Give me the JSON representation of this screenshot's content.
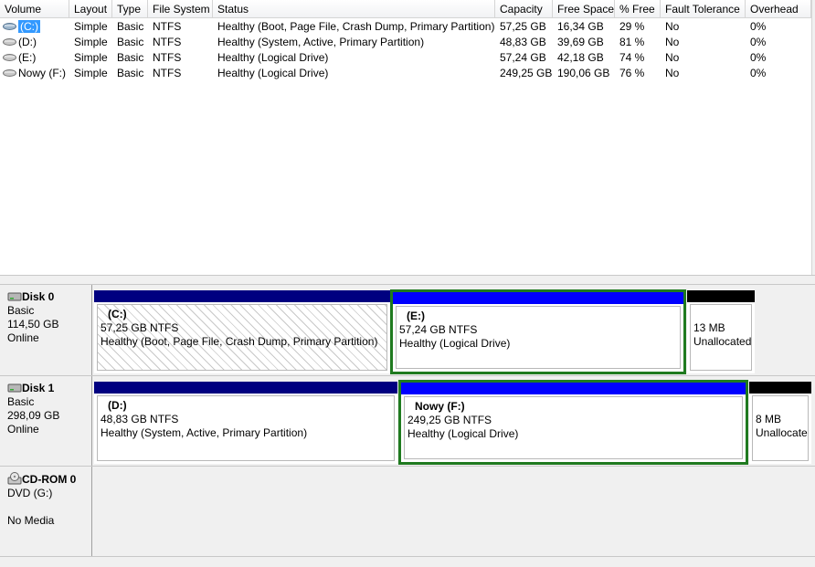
{
  "columns": [
    "Volume",
    "Layout",
    "Type",
    "File System",
    "Status",
    "Capacity",
    "Free Space",
    "% Free",
    "Fault Tolerance",
    "Overhead"
  ],
  "volumes": [
    {
      "volume": "(C:)",
      "layout": "Simple",
      "type": "Basic",
      "fs": "NTFS",
      "status": "Healthy (Boot, Page File, Crash Dump, Primary Partition)",
      "capacity": "57,25 GB",
      "free": "16,34 GB",
      "pct": "29 %",
      "fault": "No",
      "overhead": "0%"
    },
    {
      "volume": "(D:)",
      "layout": "Simple",
      "type": "Basic",
      "fs": "NTFS",
      "status": "Healthy (System, Active, Primary Partition)",
      "capacity": "48,83 GB",
      "free": "39,69 GB",
      "pct": "81 %",
      "fault": "No",
      "overhead": "0%"
    },
    {
      "volume": "(E:)",
      "layout": "Simple",
      "type": "Basic",
      "fs": "NTFS",
      "status": "Healthy (Logical Drive)",
      "capacity": "57,24 GB",
      "free": "42,18 GB",
      "pct": "74 %",
      "fault": "No",
      "overhead": "0%"
    },
    {
      "volume": "Nowy (F:)",
      "layout": "Simple",
      "type": "Basic",
      "fs": "NTFS",
      "status": "Healthy (Logical Drive)",
      "capacity": "249,25 GB",
      "free": "190,06 GB",
      "pct": "76 %",
      "fault": "No",
      "overhead": "0%"
    }
  ],
  "disks": [
    {
      "name": "Disk 0",
      "type": "Basic",
      "size": "114,50 GB",
      "state": "Online",
      "partitions": [
        {
          "label": "(C:)",
          "size": "57,25 GB NTFS",
          "status": "Healthy (Boot, Page File, Crash Dump, Primary Partition)"
        },
        {
          "label": "(E:)",
          "size": "57,24 GB NTFS",
          "status": "Healthy (Logical Drive)"
        },
        {
          "label": "",
          "size": "13 MB",
          "status": "Unallocated"
        }
      ]
    },
    {
      "name": "Disk 1",
      "type": "Basic",
      "size": "298,09 GB",
      "state": "Online",
      "partitions": [
        {
          "label": "(D:)",
          "size": "48,83 GB NTFS",
          "status": "Healthy (System, Active, Primary Partition)"
        },
        {
          "label": "Nowy  (F:)",
          "size": "249,25 GB NTFS",
          "status": "Healthy (Logical Drive)"
        },
        {
          "label": "",
          "size": "8 MB",
          "status": "Unallocated"
        }
      ]
    },
    {
      "name": "CD-ROM 0",
      "type": "DVD (G:)",
      "size": "",
      "state": "No Media",
      "partitions": []
    }
  ],
  "colors": {
    "primary_bar": "#000080",
    "logical_bar": "#0000ff",
    "unallocated_bar": "#000000",
    "selection_frame": "#1f7a1f",
    "selected_volume_bg": "#3399ff"
  },
  "icons": {
    "volume": "drive-icon",
    "disk": "disk-icon",
    "cdrom": "cdrom-icon"
  }
}
